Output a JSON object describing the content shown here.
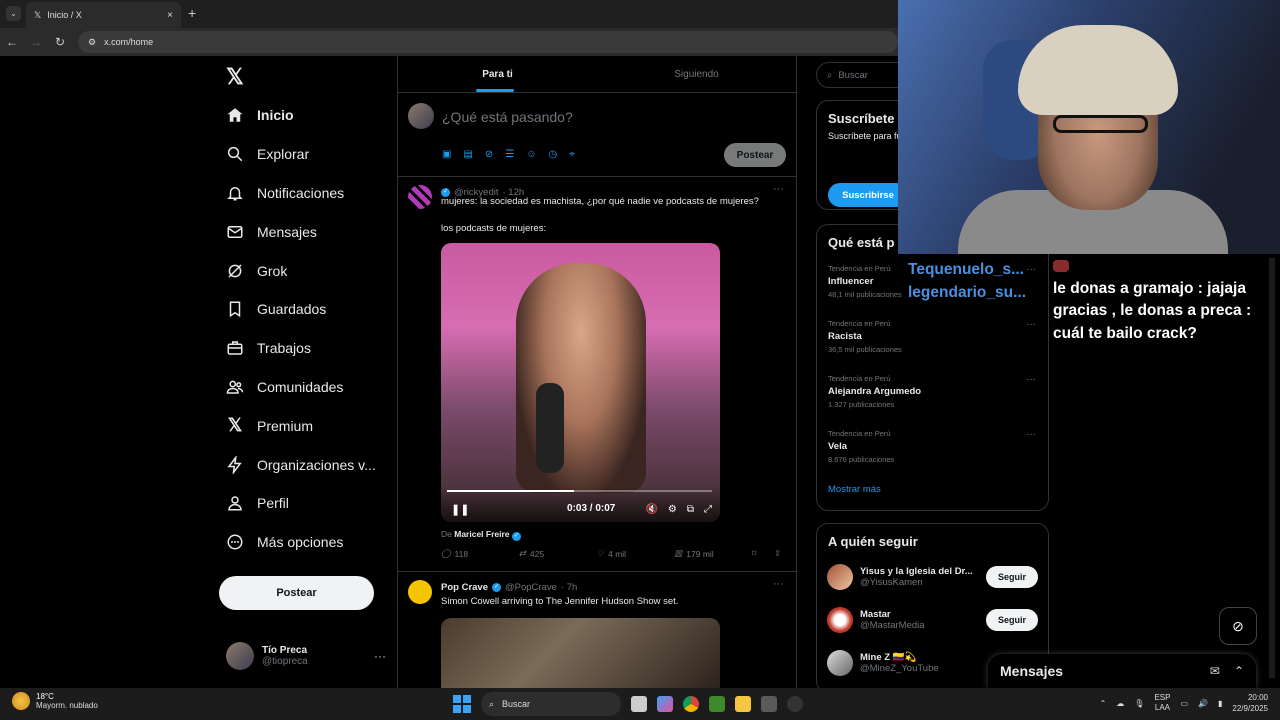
{
  "browser": {
    "tab_title": "Inicio / X",
    "tab_close": "×",
    "new_tab": "+",
    "url": "x.com/home"
  },
  "sidebar": {
    "logo": "𝕏",
    "items": [
      {
        "label": "Inicio",
        "icon": "home-icon"
      },
      {
        "label": "Explorar",
        "icon": "search-icon"
      },
      {
        "label": "Notificaciones",
        "icon": "bell-icon"
      },
      {
        "label": "Mensajes",
        "icon": "mail-icon"
      },
      {
        "label": "Grok",
        "icon": "grok-icon"
      },
      {
        "label": "Guardados",
        "icon": "bookmark-icon"
      },
      {
        "label": "Trabajos",
        "icon": "briefcase-icon"
      },
      {
        "label": "Comunidades",
        "icon": "people-icon"
      },
      {
        "label": "Premium",
        "icon": "x-logo-icon"
      },
      {
        "label": "Organizaciones v...",
        "icon": "lightning-icon"
      },
      {
        "label": "Perfil",
        "icon": "person-icon"
      },
      {
        "label": "Más opciones",
        "icon": "more-circle-icon"
      }
    ],
    "post_button": "Postear",
    "profile": {
      "name": "Tío Preca",
      "handle": "@tiopreca"
    }
  },
  "feed": {
    "tabs": [
      "Para ti",
      "Siguiendo"
    ],
    "composer_placeholder": "¿Qué está pasando?",
    "composer_post": "Postear",
    "tweets": [
      {
        "handle": "@rickyedit",
        "time": "· 12h",
        "text1": "mujeres: la sociedad es machista, ¿por qué nadie ve podcasts de mujeres?",
        "text2": "los podcasts de mujeres:",
        "video_time": "0:03 / 0:07",
        "video_progress": 0.48,
        "attrib_prefix": "De",
        "attrib_name": "Maricel Freire",
        "replies": "118",
        "reposts": "425",
        "likes": "4 mil",
        "views": "179 mil"
      },
      {
        "name": "Pop Crave",
        "handle": "@PopCrave",
        "time": "· 7h",
        "text1": "Simon Cowell arriving to The Jennifer Hudson Show set."
      }
    ]
  },
  "right": {
    "search_placeholder": "Buscar",
    "subscribe": {
      "title": "Suscríbete",
      "body": "Suscríbete para funciones y, si e de cuota de ing",
      "button": "Suscribirse"
    },
    "trends_title": "Qué está p",
    "trends": [
      {
        "category": "Tendencia en Perú",
        "name": "Influencer",
        "count": "48,1 mil publicaciones"
      },
      {
        "category": "Tendencia en Perú",
        "name": "Racista",
        "count": "36,5 mil publicaciones"
      },
      {
        "category": "Tendencia en Perú",
        "name": "Alejandra Argumedo",
        "count": "1.327 publicaciones"
      },
      {
        "category": "Tendencia en Perú",
        "name": "Vela",
        "count": "8.676 publicaciones"
      }
    ],
    "show_more": "Mostrar más",
    "follow_title": "A quién seguir",
    "follow": [
      {
        "name": "Yisus y la Iglesia del Dr...",
        "handle": "@YisusKamen",
        "button": "Seguir"
      },
      {
        "name": "Mastar",
        "handle": "@MastarMedia",
        "button": "Seguir"
      },
      {
        "name": "Mine Z 🇨🇴💫",
        "handle": "@MineZ_YouTube",
        "button": "Seguir"
      }
    ]
  },
  "stream_overlay": {
    "donors": [
      "Tequenuelo_s...",
      "legendario_su..."
    ],
    "chat_message": "le donas a gramajo : jajaja gracias , le donas a preca : cuál te bailo crack?"
  },
  "messages_drawer": {
    "title": "Mensajes"
  },
  "taskbar": {
    "weather_temp": "18°C",
    "weather_desc": "Mayorm. nublado",
    "search": "Buscar",
    "lang1": "ESP",
    "lang2": "LAA",
    "time": "20:00",
    "date": "22/9/2025"
  }
}
